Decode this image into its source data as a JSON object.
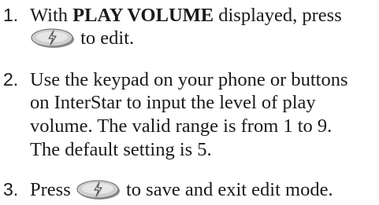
{
  "steps": [
    {
      "number": "1.",
      "lines": [
        {
          "before": "With ",
          "bold": "PLAY VOLUME",
          "after": " displayed, press"
        },
        {
          "after": " to edit."
        }
      ],
      "icon": "rocker-button-icon"
    },
    {
      "number": "2.",
      "lines": [
        "Use the keypad on your phone or buttons",
        "on InterStar to input the level of play",
        "volume. The valid range is from 1 to 9.",
        "The default setting is 5."
      ]
    },
    {
      "number": "3.",
      "lines": [
        {
          "before": "Press ",
          "after": " to save and exit edit mode."
        }
      ],
      "icon": "rocker-button-icon"
    }
  ],
  "colors": {
    "text": "#1a1a1a",
    "button_fill": "#cfcfcf",
    "button_shadow": "#8c8c8c"
  }
}
